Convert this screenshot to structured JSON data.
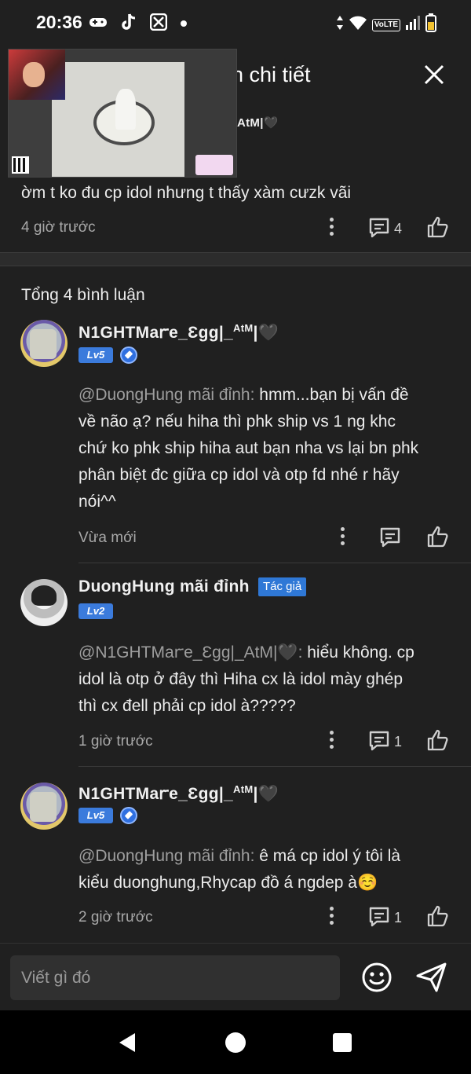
{
  "status_bar": {
    "time": "20:36",
    "lte": "VoLTE",
    "left_icons": [
      "game-controller-icon",
      "tiktok-icon",
      "app-icon",
      "dot-icon"
    ],
    "right_icons": [
      "data-arrows-icon",
      "wifi-icon",
      "volte-icon",
      "signal-icon",
      "battery-icon"
    ]
  },
  "header": {
    "title": "n chi tiết",
    "close_icon": "close-icon"
  },
  "top_comment": {
    "username_tail": "AtM|🖤",
    "text": "ờm t ko đu cp idol nhưng t thấy xàm cưzk vãi",
    "time": "4 giờ trước",
    "reply_count": "4"
  },
  "replies_section": {
    "total_label": "Tổng 4 bình luận",
    "replies": [
      {
        "username": "N1GHTMaꭈe_Ɛgg|_",
        "username_sup": "AtM",
        "username_suffix": "|🖤",
        "level": "Lv5",
        "mention": "@DuongHung mãi đỉnh:",
        "text_lines": [
          " hmm...bạn bị vấn đề",
          "về não ạ? nếu hiha thì phk ship vs 1 ng khc",
          "chứ ko phk ship hiha aut bạn nha vs lại bn phk",
          "phân biệt đc giữa cp idol và otp fd nhé r hãy",
          "nói^^"
        ],
        "time": "Vừa mới",
        "reply_count": ""
      },
      {
        "username": "DuongHung mãi đỉnh",
        "author_badge": "Tác giả",
        "level": "Lv2",
        "mention": "@N1GHTMaꭈe_Ɛgg|_AtM|🖤:",
        "text_lines": [
          " hiểu không. cp",
          "idol là otp ở đây thì Hiha cx là idol mày ghép",
          "thì cx đell phải cp idol à?????"
        ],
        "time": "1 giờ trước",
        "reply_count": "1"
      },
      {
        "username": "N1GHTMaꭈe_Ɛgg|_",
        "username_sup": "AtM",
        "username_suffix": "|🖤",
        "level": "Lv5",
        "mention": "@DuongHung mãi đỉnh:",
        "text_lines": [
          " ê má cp idol ý tôi là",
          "kiểu duonghung,Rhycap đồ á ngdep à☺️"
        ],
        "time": "2 giờ trước",
        "reply_count": "1"
      }
    ]
  },
  "composer": {
    "placeholder": "Viết gì đó",
    "emoji_icon": "emoji-icon",
    "send_icon": "send-icon"
  },
  "nav": {
    "icons": [
      "back-triangle-icon",
      "home-circle-icon",
      "recents-square-icon"
    ]
  }
}
